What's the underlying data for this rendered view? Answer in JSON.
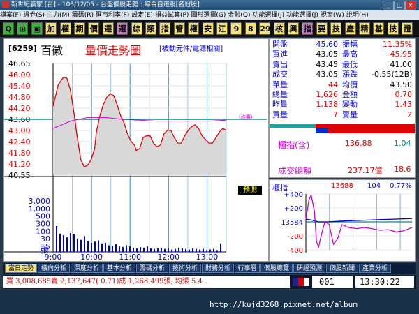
{
  "window": {
    "title": "新世紀贏家 [台] - 103/12/05 - 台盤個股走勢 : 綜合自選股[名冠股]"
  },
  "menu": [
    "檔案(F)",
    "證券(S)",
    "主力(M)",
    "籌碼(R)",
    "匯市利率(F)",
    "設定(E)",
    "損益試算(P)",
    "圖形選擇(G)",
    "金融(Q)",
    "功能選擇(J)",
    "功能選擇(J)",
    "視窗(W)",
    "說明(H)"
  ],
  "toolbar": {
    "buttons": [
      "Q",
      "⊞",
      "▣",
      "加",
      "權",
      "期",
      "價",
      "選",
      "選",
      "綜",
      "類",
      "指",
      "管",
      "權",
      "安",
      "江",
      "9",
      "8",
      "29",
      "核",
      "興",
      "指",
      "要",
      "技",
      "產",
      "精",
      "基",
      "技",
      "證"
    ],
    "colors": [
      "#3cb43c",
      "#3cb43c",
      "#3cb43c",
      "#f6e27a",
      "#f6e27a",
      "#f6e27a",
      "#f6e27a",
      "#f6e27a",
      "#c080c0",
      "#f6e27a",
      "#f6e27a",
      "#f6e27a",
      "#f6e27a",
      "#f6e27a",
      "#f6e27a",
      "#f6e27a",
      "#f6e27a",
      "#f6e27a",
      "#f6e27a",
      "#f6e27a",
      "#f6e27a",
      "#c080c0",
      "#f6e27a",
      "#f6e27a",
      "#f6e27a",
      "#f6e27a",
      "#f6e27a",
      "#f6e27a",
      "#f6e27a"
    ]
  },
  "stock": {
    "code": "[6259]",
    "name": "百徽",
    "chart_title": "量價走勢圖",
    "link_text": "[被動元件/電源相關]",
    "avg_line_label": "(均價)",
    "prediction_button": "預測"
  },
  "quote": {
    "rows": [
      {
        "l1": "開盤",
        "v1": "45.60",
        "l2": "振幅",
        "v2": "11.35%",
        "c1": "#00c",
        "c2": "#d00"
      },
      {
        "l1": "買進",
        "v1": "43.05",
        "l2": "最高",
        "v2": "45.95",
        "c1": "#000",
        "c2": "#d00"
      },
      {
        "l1": "賣出",
        "v1": "43.45",
        "l2": "最低",
        "v2": "41.00",
        "c1": "#000",
        "c2": "#000"
      },
      {
        "l1": "成交",
        "v1": "43.05",
        "l2": "漲跌",
        "v2": "-0.55(12B)",
        "c1": "#000",
        "c2": "#000"
      },
      {
        "l1": "單量",
        "v1": "44",
        "l2": "均價",
        "v2": "43.50",
        "c1": "#d00",
        "c2": "#000"
      },
      {
        "l1": "總量",
        "v1": "1,626",
        "l2": "金額",
        "v2": "0.70",
        "c1": "#d00",
        "c2": "#d00"
      },
      {
        "l1": "昨量",
        "v1": "1,138",
        "l2": "變動",
        "v2": "1.43",
        "c1": "#d00",
        "c2": "#d00"
      },
      {
        "l1": "買量",
        "v1": "7",
        "l2": "賣量",
        "v2": "2",
        "c1": "#d00",
        "c2": "#d00"
      }
    ],
    "counter_label": "櫃指(含)",
    "counter_value": "136.88",
    "counter_change": "1.04",
    "total_label": "成交總額",
    "total_value": "237.17億",
    "total_change": "18.6"
  },
  "indicator": {
    "label": "櫃指",
    "value": "13688",
    "change": "104",
    "pct": "0.77%",
    "axis": [
      "+400",
      "+200",
      "13584",
      "-200",
      "-400"
    ]
  },
  "chart_data": {
    "type": "line",
    "price_axis": [
      "46.65",
      "46.00",
      "45.40",
      "44.80",
      "44.20",
      "43.60",
      "43.00",
      "42.40",
      "41.80",
      "41.20",
      "40.55"
    ],
    "volume_axis": [
      "3,000",
      "1,000",
      "500",
      "300",
      "100",
      "30",
      "15"
    ],
    "volume_unit": "張",
    "time_axis": [
      "9:00",
      "10:00",
      "11:00",
      "12:00",
      "13:00"
    ],
    "ref_price": 43.6,
    "ylim": [
      40.55,
      46.65
    ],
    "price_series": [
      [
        0,
        44.3
      ],
      [
        3,
        45.5
      ],
      [
        6,
        45.9
      ],
      [
        8,
        45.85
      ],
      [
        10,
        45.2
      ],
      [
        12,
        44.0
      ],
      [
        14,
        42.6
      ],
      [
        16,
        41.4
      ],
      [
        18,
        41.0
      ],
      [
        20,
        41.1
      ],
      [
        22,
        41.4
      ],
      [
        24,
        42.0
      ],
      [
        25,
        42.9
      ],
      [
        27,
        43.8
      ],
      [
        29,
        44.4
      ],
      [
        31,
        44.8
      ],
      [
        33,
        45.0
      ],
      [
        35,
        44.9
      ],
      [
        37,
        44.4
      ],
      [
        39,
        43.8
      ],
      [
        41,
        43.4
      ],
      [
        43,
        42.8
      ],
      [
        45,
        42.4
      ],
      [
        47,
        42.2
      ],
      [
        48,
        41.9
      ],
      [
        50,
        42.0
      ],
      [
        52,
        42.6
      ],
      [
        54,
        42.7
      ],
      [
        56,
        42.7
      ],
      [
        58,
        42.3
      ],
      [
        60,
        42.1
      ],
      [
        62,
        42.2
      ],
      [
        64,
        42.8
      ],
      [
        66,
        43.0
      ],
      [
        68,
        43.0
      ],
      [
        70,
        42.6
      ],
      [
        72,
        42.3
      ],
      [
        74,
        42.3
      ],
      [
        76,
        42.7
      ],
      [
        78,
        43.0
      ],
      [
        80,
        43.2
      ],
      [
        82,
        43.3
      ],
      [
        84,
        43.1
      ],
      [
        86,
        42.7
      ],
      [
        88,
        42.5
      ],
      [
        90,
        42.3
      ],
      [
        92,
        42.3
      ],
      [
        94,
        42.6
      ],
      [
        96,
        42.9
      ],
      [
        98,
        43.1
      ],
      [
        100,
        43.0
      ]
    ],
    "avg_series": [
      [
        0,
        43.1
      ],
      [
        10,
        43.5
      ],
      [
        20,
        43.7
      ],
      [
        30,
        43.7
      ],
      [
        40,
        43.6
      ],
      [
        50,
        43.55
      ],
      [
        60,
        43.5
      ],
      [
        70,
        43.5
      ],
      [
        80,
        43.5
      ],
      [
        90,
        43.5
      ],
      [
        100,
        43.55
      ]
    ],
    "volume_bars": [
      85,
      60,
      55,
      48,
      62,
      58,
      44,
      40,
      52,
      36,
      30,
      34,
      38,
      28,
      30,
      22,
      20,
      26,
      18,
      16,
      22,
      18,
      14,
      12,
      16,
      14,
      18,
      12,
      10,
      12,
      14,
      10,
      12,
      8,
      10,
      14,
      12,
      10,
      8,
      12,
      10,
      8,
      10,
      6,
      8,
      10,
      6,
      28
    ]
  },
  "bottom_tabs": [
    "當日走勢",
    "橫向分析",
    "深度分析",
    "基本分析",
    "籌碼分析",
    "技術分析",
    "財務分析",
    "行事曆",
    "個股總覽",
    "研經預測",
    "個股新聞",
    "產業分析"
  ],
  "status": {
    "text": "買 3,008,685賣 2,137,647( 0.71)成 1,268,499張, 均張 5.4",
    "code_box": "001",
    "time": "13:30:22"
  },
  "footer": {
    "url": "http://kujd3268.pixnet.net/album"
  }
}
